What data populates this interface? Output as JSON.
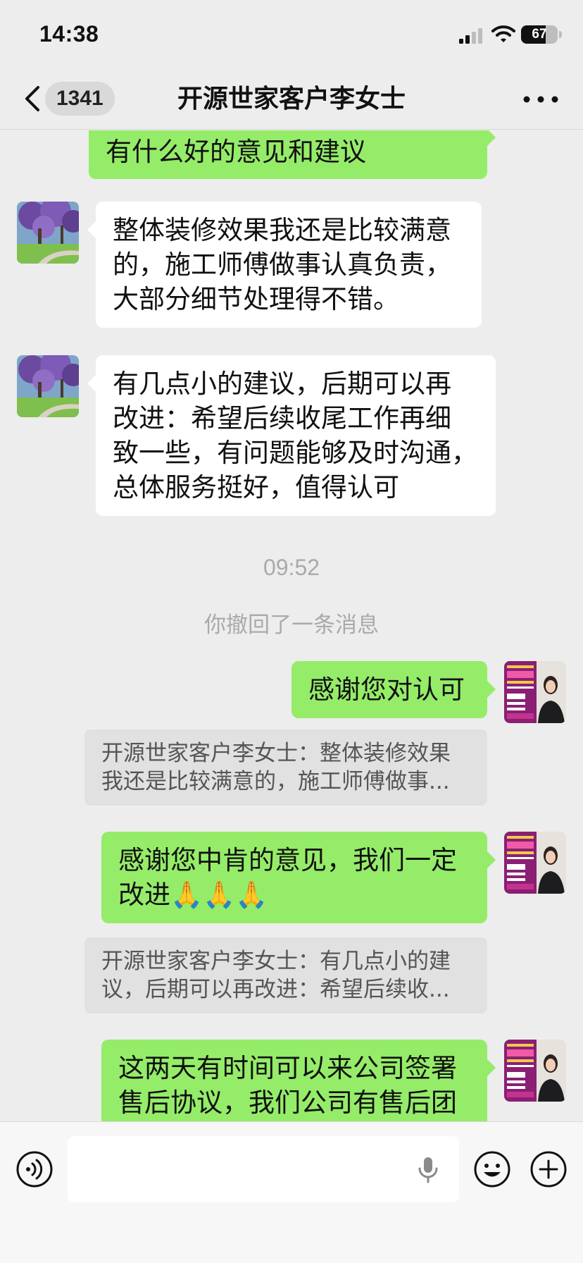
{
  "status_bar": {
    "time": "14:38",
    "battery_level": "67",
    "icons": [
      "cellular-signal-icon",
      "wifi-icon",
      "battery-icon"
    ]
  },
  "nav": {
    "back_icon": "chevron-left-icon",
    "unread_count": "1341",
    "title": "开源世家客户李女士",
    "more_icon": "more-dots-icon"
  },
  "messages": {
    "m0": {
      "lines": [
        "有什么好的意见和建议"
      ]
    },
    "m1": {
      "lines": [
        "整体装修效果我还是比较满意",
        "的，施工师傅做事认真负责，",
        "大部分细节处理得不错。"
      ]
    },
    "m2": {
      "lines": [
        "有几点小的建议，后期可以再",
        "改进：希望后续收尾工作再细",
        "致一些，有问题能够及时沟通，",
        "总体服务挺好，值得认可"
      ]
    },
    "timestamp": "09:52",
    "recalled": "你撤回了一条消息",
    "m3": {
      "lines": [
        "感谢您对认可"
      ]
    },
    "q1": {
      "lines": [
        "开源世家客户李女士：整体装修效果",
        "我还是比较满意的，施工师傅做事..."
      ]
    },
    "m4": {
      "lines": [
        "感谢您中肯的意见，我们一定",
        "改进🙏🙏🙏"
      ]
    },
    "q2": {
      "lines": [
        "开源世家客户李女士：有几点小的建",
        "议，后期可以再改进：希望后续收..."
      ]
    },
    "m5": {
      "lines": [
        "这两天有时间可以来公司签署",
        "售后协议，我们公司有售后团"
      ]
    }
  },
  "input_bar": {
    "placeholder": "",
    "voice_icon": "voice-icon",
    "mic_icon": "microphone-icon",
    "emoji_icon": "emoji-icon",
    "plus_icon": "plus-icon"
  },
  "colors": {
    "background": "#ededed",
    "outgoing_bubble": "#95ec69",
    "incoming_bubble": "#ffffff",
    "quote_bg": "#e1e1e1"
  }
}
